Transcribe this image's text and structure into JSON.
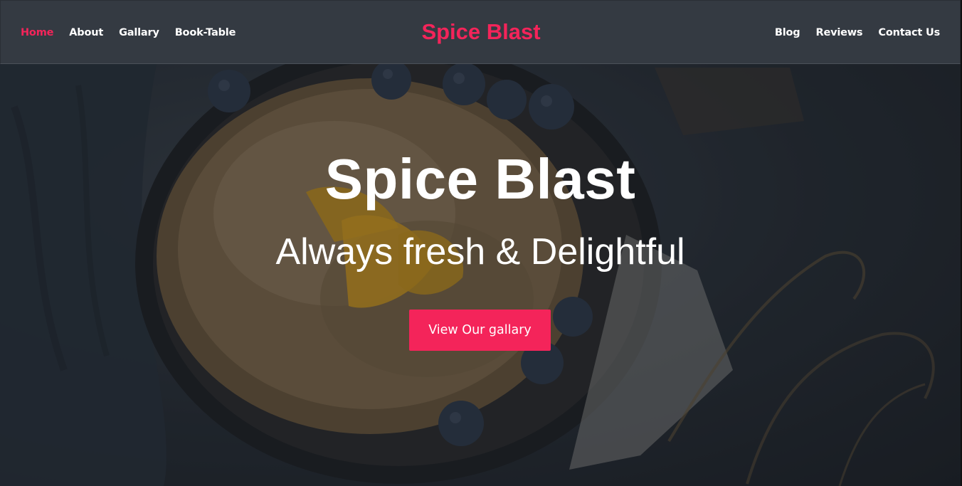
{
  "navbar": {
    "brand": "Spice Blast",
    "left_links": [
      {
        "label": "Home",
        "active": true
      },
      {
        "label": "About",
        "active": false
      },
      {
        "label": "Gallary",
        "active": false
      },
      {
        "label": "Book-Table",
        "active": false
      }
    ],
    "right_links": [
      {
        "label": "Blog"
      },
      {
        "label": "Reviews"
      },
      {
        "label": "Contact Us"
      }
    ]
  },
  "hero": {
    "title": "Spice Blast",
    "subtitle": "Always fresh & Delightful",
    "cta_label": "View Our gallary",
    "background_icon": "food-photo-pancake-blueberries"
  },
  "colors": {
    "accent": "#f4245a",
    "navbar_bg": "#343a42",
    "text_light": "#ffffff"
  }
}
